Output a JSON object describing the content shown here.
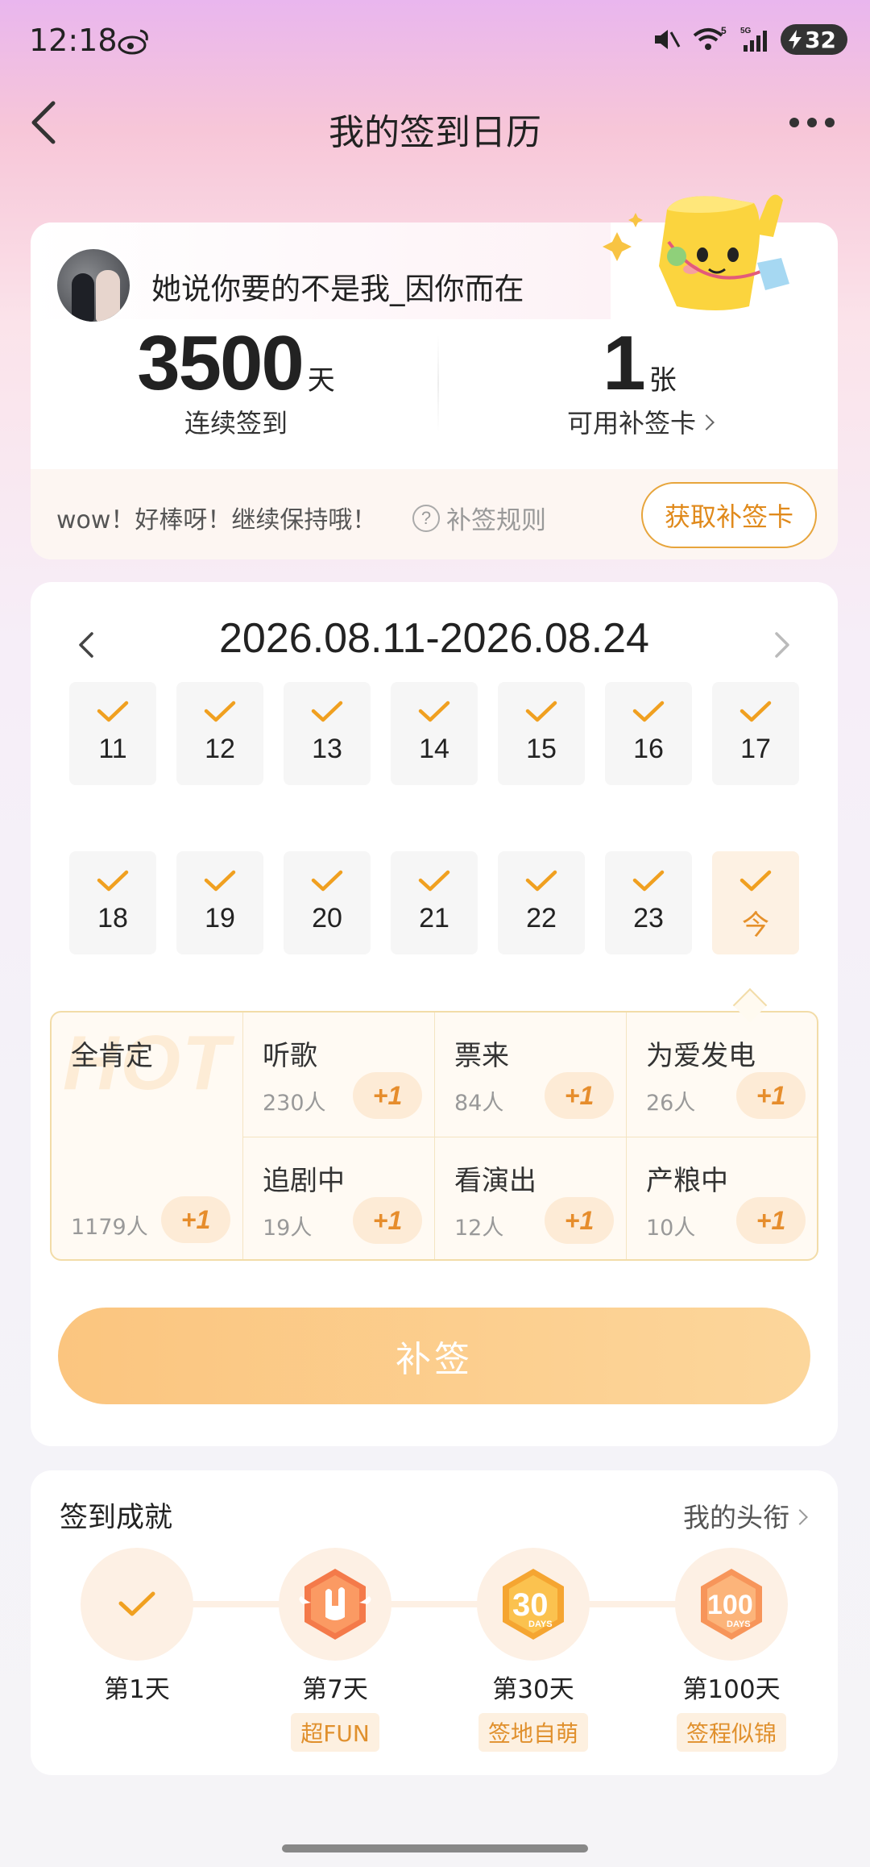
{
  "status": {
    "time": "12:18",
    "battery": "32",
    "network": "5G"
  },
  "nav": {
    "title": "我的签到日历"
  },
  "profile": {
    "username": "她说你要的不是我_因你而在",
    "streak_value": "3500",
    "streak_unit": "天",
    "streak_label": "连续签到",
    "cards_value": "1",
    "cards_unit": "张",
    "cards_label": "可用补签卡",
    "message": "wow！好棒呀！继续保持哦！",
    "rule_label": "补签规则",
    "get_card_label": "获取补签卡"
  },
  "calendar": {
    "range": "2026.08.11-2026.08.24",
    "week1": [
      "11",
      "12",
      "13",
      "14",
      "15",
      "16",
      "17"
    ],
    "week2": [
      "18",
      "19",
      "20",
      "21",
      "22",
      "23",
      "今"
    ]
  },
  "moods": {
    "hot_watermark": "HOT",
    "featured": {
      "name": "全肯定",
      "count": "1179人",
      "plus": "+1"
    },
    "items": [
      {
        "name": "听歌",
        "count": "230人",
        "plus": "+1"
      },
      {
        "name": "票来",
        "count": "84人",
        "plus": "+1"
      },
      {
        "name": "为爱发电",
        "count": "26人",
        "plus": "+1"
      },
      {
        "name": "追剧中",
        "count": "19人",
        "plus": "+1"
      },
      {
        "name": "看演出",
        "count": "12人",
        "plus": "+1"
      },
      {
        "name": "产粮中",
        "count": "10人",
        "plus": "+1"
      }
    ]
  },
  "sign_button": "补签",
  "achievements": {
    "title": "签到成就",
    "link": "我的头衔",
    "items": [
      {
        "label": "第1天",
        "tag": ""
      },
      {
        "label": "第7天",
        "tag": "超FUN"
      },
      {
        "label": "第30天",
        "tag": "签地自萌"
      },
      {
        "label": "第100天",
        "tag": "签程似锦"
      }
    ]
  },
  "colors": {
    "accent": "#e68d2c",
    "button": "#fbc57f"
  }
}
